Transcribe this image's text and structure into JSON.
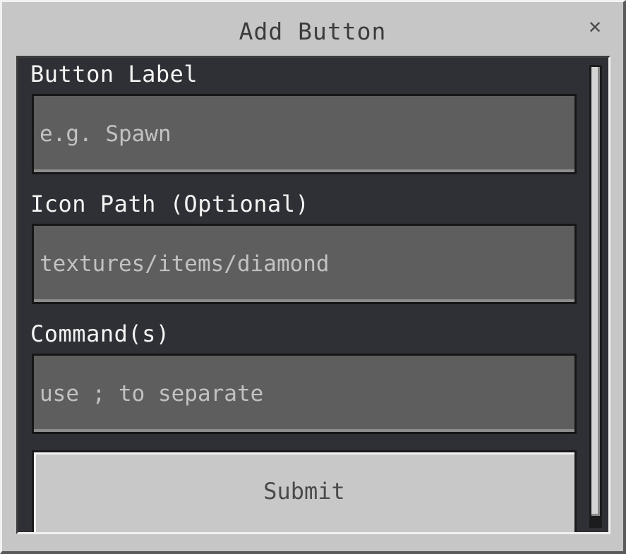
{
  "dialog": {
    "title": "Add Button",
    "close_glyph": "✕",
    "close_icon": "close-icon"
  },
  "form": {
    "fields": [
      {
        "label": "Button Label",
        "value": "",
        "placeholder": "e.g. Spawn"
      },
      {
        "label": "Icon Path (Optional)",
        "value": "",
        "placeholder": "textures/items/diamond"
      },
      {
        "label": "Command(s)",
        "value": "",
        "placeholder": "use ; to separate"
      }
    ],
    "submit_label": "Submit"
  },
  "scrollbar": {
    "position": 0.0
  },
  "colors": {
    "panel": "#c6c6c6",
    "content_bg": "#2f3035",
    "input_bg": "#5e5e5e",
    "label_text": "#f4f4f4",
    "button_bg": "#c8c8c8"
  }
}
